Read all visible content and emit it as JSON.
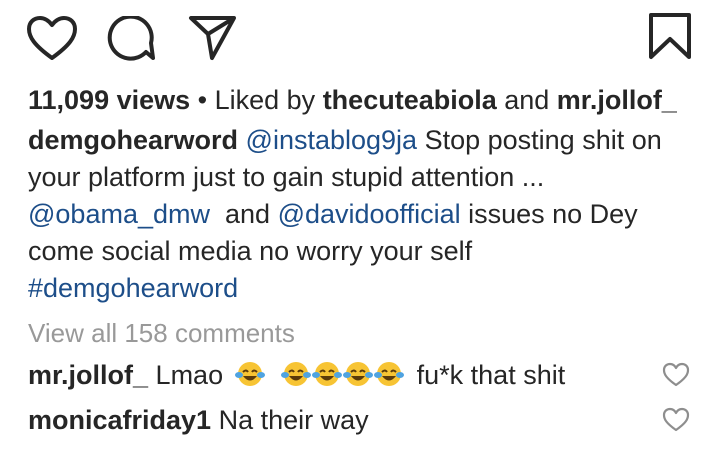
{
  "actions": {
    "like_icon": "heart-outline",
    "comment_icon": "speech-bubble",
    "share_icon": "paper-plane",
    "save_icon": "bookmark"
  },
  "stats": {
    "views": "11,099 views",
    "separator": " • Liked by ",
    "liker1": "thecuteabiola",
    "and": " and ",
    "liker2": "mr.jollof_"
  },
  "caption": {
    "username": "demgohearword",
    "mention1": "@instablog9ja",
    "text1": " Stop posting shit on your platform just to gain stupid attention ...",
    "mention2": "@obama_dmw",
    "text2": "  and ",
    "mention3": "@davidoofficial",
    "text3": " issues no Dey come social media no worry your self",
    "hashtag": "#demgohearword"
  },
  "view_all": "View all 158 comments",
  "comments": [
    {
      "username": "mr.jollof_",
      "text_before": "Lmao",
      "emoji": "face-with-tears-of-joy",
      "text_after": "fu*k that shit"
    },
    {
      "username": "monicafriday1",
      "text": "Na their way"
    }
  ],
  "colors": {
    "text": "#262626",
    "link": "#1d4e89",
    "muted": "#999999",
    "emoji_face": "#f7c434"
  }
}
